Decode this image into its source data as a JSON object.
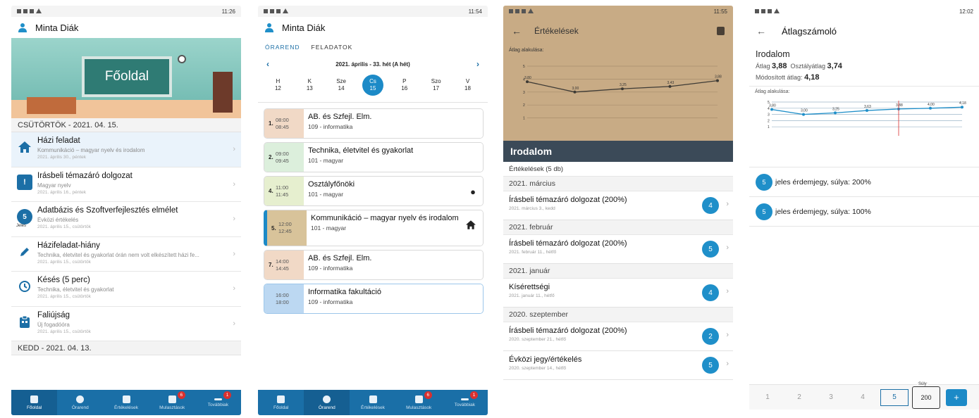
{
  "p1": {
    "time": "11:26",
    "user": "Minta Diák",
    "hero_label": "Főoldal",
    "day1": "CSÜTÖRTÖK - 2021. 04. 15.",
    "items": [
      {
        "title": "Házi feladat",
        "sub": "Kommunikáció – magyar nyelv és irodalom",
        "date": "2021. április 30., péntek"
      },
      {
        "title": "Írásbeli témazáró dolgozat",
        "sub": "Magyar nyelv",
        "date": "2021. április 16., péntek"
      },
      {
        "title": "Adatbázis és Szoftverfejlesztés elmélet",
        "sub": "Évközi értékelés",
        "date": "2021. április 15., csütörtök",
        "grade": "5",
        "grade_label": "Jeles"
      },
      {
        "title": "Házifeladat-hiány",
        "sub": "Technika, életvitel és gyakorlat órán nem volt elkészített házi fe...",
        "date": "2021. április 15., csütörtök"
      },
      {
        "title": "Késés (5 perc)",
        "sub": "Technika, életvitel és gyakorlat",
        "date": "2021. április 15., csütörtök"
      },
      {
        "title": "Faliújság",
        "sub": "Új fogadóóra",
        "date": "2021. április 15., csütörtök"
      }
    ],
    "day2": "KEDD - 2021. 04. 13."
  },
  "nav": {
    "items": [
      "Főoldal",
      "Órarend",
      "Értékelések",
      "Mulasztások",
      "Továbbiak"
    ],
    "badge_absence": "6",
    "badge_more": "1"
  },
  "p2": {
    "time": "11:54",
    "user": "Minta Diák",
    "tab_timetable": "ÓRAREND",
    "tab_tasks": "FELADATOK",
    "week": "2021. április - 33. hét (A hét)",
    "days": [
      {
        "d": "H",
        "n": "12"
      },
      {
        "d": "K",
        "n": "13"
      },
      {
        "d": "Sze",
        "n": "14"
      },
      {
        "d": "Cs",
        "n": "15"
      },
      {
        "d": "P",
        "n": "16"
      },
      {
        "d": "Szo",
        "n": "17"
      },
      {
        "d": "V",
        "n": "18"
      }
    ],
    "lessons": [
      {
        "num": "1.",
        "from": "08:00",
        "to": "08:45",
        "title": "AB. és Szfejl. Elm.",
        "room": "109 - informatika",
        "color": "#f1d9c6"
      },
      {
        "num": "2.",
        "from": "09:00",
        "to": "09:45",
        "title": "Technika, életvitel és gyakorlat",
        "room": "101 - magyar",
        "color": "#dcefdc"
      },
      {
        "num": "4.",
        "from": "11:00",
        "to": "11:45",
        "title": "Osztályfőnöki",
        "room": "101 - magyar",
        "color": "#e6efcf"
      },
      {
        "num": "5.",
        "from": "12:00",
        "to": "12:45",
        "title": "Kommunikáció – magyar nyelv és irodalom",
        "room": "101 - magyar",
        "color": "#d8c39a"
      },
      {
        "num": "7.",
        "from": "14:00",
        "to": "14:45",
        "title": "AB. és Szfejl. Elm.",
        "room": "109 - informatika",
        "color": "#f1d9c6"
      },
      {
        "num": "",
        "from": "16:00",
        "to": "18:00",
        "title": "Informatika fakultáció",
        "room": "109 - informatika",
        "color": "#bcd8f2"
      }
    ]
  },
  "p3": {
    "time": "11:55",
    "title": "Értékelések",
    "chart_caption": "Átlag alakulása:",
    "subject": "Irodalom",
    "count": "Értékelések (5 db)",
    "sections": [
      {
        "month": "2021. március",
        "title": "Írásbeli témazáró dolgozat (200%)",
        "date": "2021. március 3., kedd",
        "grade": "4"
      },
      {
        "month": "2021. február",
        "title": "Írásbeli témazáró dolgozat (200%)",
        "date": "2021. február 11., hétfő",
        "grade": "5"
      },
      {
        "month": "2021. január",
        "title": "Kísérettségi",
        "date": "2021. január 11., hétfő",
        "grade": "4"
      },
      {
        "month": "2020. szeptember",
        "title": "Írásbeli témazáró dolgozat (200%)",
        "date": "2020. szeptember 21., hétfő",
        "grade": "2"
      },
      {
        "month": "",
        "title": "Évközi jegy/értékelés",
        "date": "2020. szeptember 14., hétfő",
        "grade": "5"
      }
    ]
  },
  "p4": {
    "time": "12:02",
    "title": "Átlagszámoló",
    "subject": "Irodalom",
    "avg_label": "Átlag",
    "avg": "3,88",
    "class_label": "Osztályátlag",
    "class_avg": "3,74",
    "mod_label": "Módosított átlag:",
    "mod_avg": "4,18",
    "chart_caption": "Átlag alakulása:",
    "rows": [
      {
        "grade": "5",
        "text": "jeles érdemjegy, súlya: 200%"
      },
      {
        "grade": "5",
        "text": "jeles érdemjegy, súlya: 100%"
      }
    ],
    "grades": [
      "1",
      "2",
      "3",
      "4",
      "5"
    ],
    "weight_label": "Súly",
    "weight": "200",
    "plus": "+"
  },
  "chart_data": [
    {
      "type": "line",
      "title": "Átlag alakulása:",
      "x": [
        1,
        2,
        3,
        4,
        5
      ],
      "series": [
        {
          "values": [
            3.8,
            3.0,
            3.25,
            3.43,
            3.88
          ]
        }
      ],
      "labels": [
        "3,80",
        "3,00",
        "3,25",
        "3,43",
        "3,88"
      ],
      "ylim": [
        0,
        5
      ]
    },
    {
      "type": "line",
      "title": "Átlag alakulása:",
      "x": [
        1,
        2,
        3,
        4,
        5,
        6,
        7
      ],
      "series": [
        {
          "values": [
            3.8,
            3.0,
            3.25,
            3.63,
            3.88,
            4.0,
            4.18
          ]
        }
      ],
      "labels": [
        "3,80",
        "3,00",
        "3,25",
        "3,63",
        "3,88",
        "4,00",
        "4,18"
      ],
      "ylim": [
        0,
        5
      ]
    }
  ]
}
